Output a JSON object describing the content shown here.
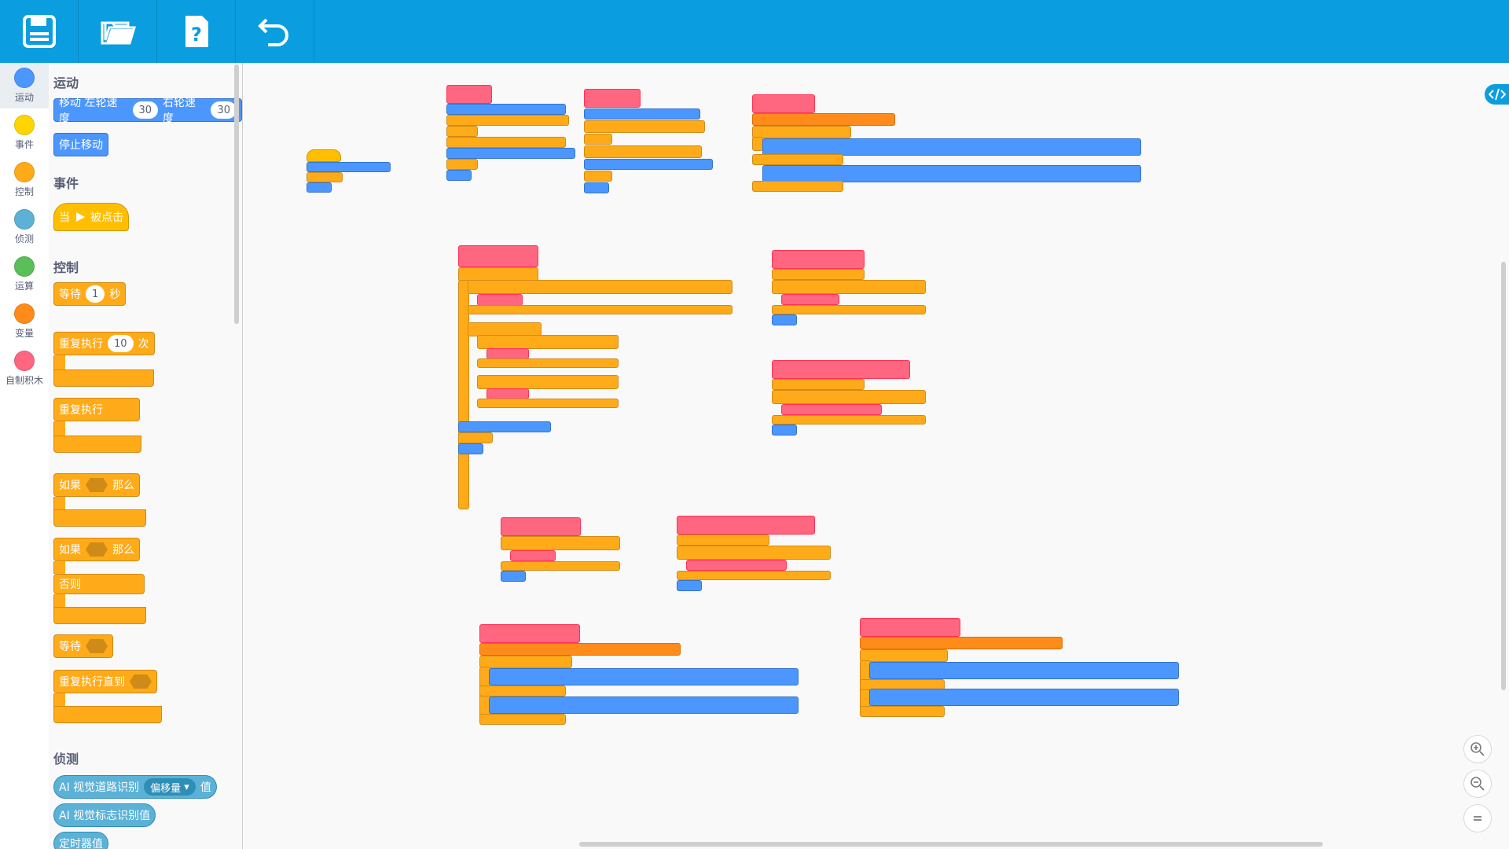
{
  "toolbar": {
    "buttons": [
      {
        "name": "save-button",
        "icon": "save-icon"
      },
      {
        "name": "open-button",
        "icon": "folder-icon"
      },
      {
        "name": "help-button",
        "icon": "help-icon"
      },
      {
        "name": "undo-button",
        "icon": "undo-icon"
      }
    ]
  },
  "categories": [
    {
      "label": "运动",
      "color": "#4c97ff"
    },
    {
      "label": "事件",
      "color": "#ffd500"
    },
    {
      "label": "控制",
      "color": "#ffab19"
    },
    {
      "label": "侦测",
      "color": "#5cb1d6"
    },
    {
      "label": "运算",
      "color": "#59c059"
    },
    {
      "label": "变量",
      "color": "#ff8c1a"
    },
    {
      "label": "自制积木",
      "color": "#ff6680"
    }
  ],
  "palette": {
    "motion_title": "运动",
    "move_left": "移动 左轮速度",
    "move_left_val": "30",
    "move_right": "右轮速度",
    "move_right_val": "30",
    "stop_move": "停止移动",
    "events_title": "事件",
    "when_label": "当",
    "clicked_label": "被点击",
    "control_title": "控制",
    "wait_label": "等待",
    "wait_val": "1",
    "wait_unit": "秒",
    "repeat_label": "重复执行",
    "repeat_val": "10",
    "repeat_unit": "次",
    "forever_label": "重复执行",
    "if_label": "如果",
    "then_label": "那么",
    "if2_label": "如果",
    "then2_label": "那么",
    "else_label": "否则",
    "wait_until_label": "等待",
    "repeat_until_label": "重复执行直到",
    "sensing_title": "侦测",
    "ai_road_label": "AI 视觉道路识别",
    "ai_road_drop": "偏移量",
    "ai_road_value": "值",
    "ai_sign_label": "AI 视觉标志识别值",
    "timer_label": "定时器值"
  },
  "zoom": {
    "zoom_in": "zoom-in-icon",
    "zoom_out": "zoom-out-icon",
    "reset": "zoom-reset-icon"
  },
  "code_tab_icon": "code-icon"
}
